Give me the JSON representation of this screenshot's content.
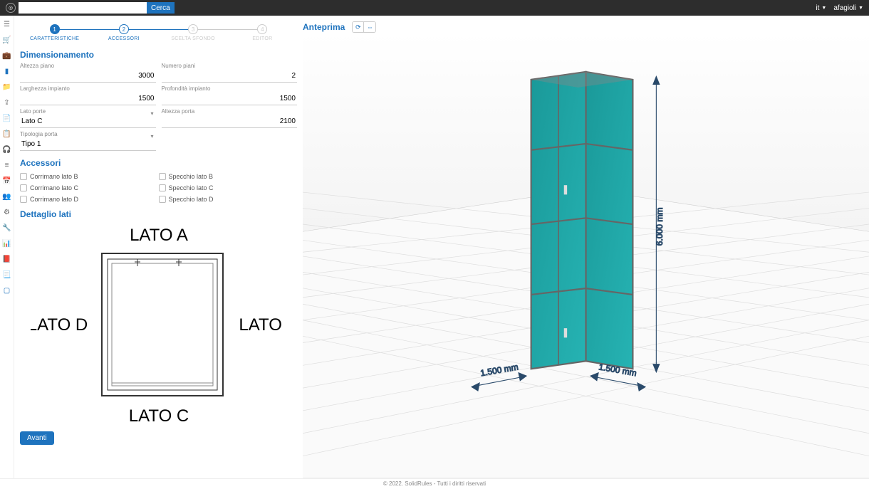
{
  "header": {
    "search_placeholder": "",
    "search_button": "Cerca",
    "lang": "it",
    "user": "afagioli"
  },
  "stepper": {
    "steps": [
      {
        "n": "1",
        "label": "CARATTERISTICHE",
        "state": "active"
      },
      {
        "n": "2",
        "label": "ACCESSORI",
        "state": "enabled"
      },
      {
        "n": "3",
        "label": "SCELTA SFONDO",
        "state": "disabled"
      },
      {
        "n": "4",
        "label": "EDITOR",
        "state": "disabled"
      }
    ]
  },
  "sections": {
    "dimensionamento": "Dimensionamento",
    "accessori": "Accessori",
    "dettaglio": "Dettaglio lati",
    "anteprima": "Anteprima"
  },
  "fields": {
    "altezza_piano": {
      "label": "Altezza piano",
      "value": "3000"
    },
    "numero_piani": {
      "label": "Numero piani",
      "value": "2"
    },
    "larghezza_impianto": {
      "label": "Larghezza impianto",
      "value": "1500"
    },
    "profondita_impianto": {
      "label": "Profondità impianto",
      "value": "1500"
    },
    "lato_porte": {
      "label": "Lato porte",
      "value": "Lato C"
    },
    "altezza_porta": {
      "label": "Altezza porta",
      "value": "2100"
    },
    "tipologia_porta": {
      "label": "Tipologia porta",
      "value": "Tipo 1"
    }
  },
  "accessori": {
    "corrimano_b": "Corrimano lato B",
    "corrimano_c": "Corrimano lato C",
    "corrimano_d": "Corrimano lato D",
    "specchio_b": "Specchio lato B",
    "specchio_c": "Specchio lato C",
    "specchio_d": "Specchio lato D"
  },
  "plan": {
    "lato_a": "LATO A",
    "lato_b": "LATO B",
    "lato_c": "LATO C",
    "lato_d": "LATO D"
  },
  "buttons": {
    "next": "Avanti"
  },
  "preview": {
    "dim_width": "1.500 mm",
    "dim_depth": "1.500 mm",
    "dim_height": "6.000 mm"
  },
  "footer": "© 2022. SolidRules - Tutti i diritti riservati"
}
